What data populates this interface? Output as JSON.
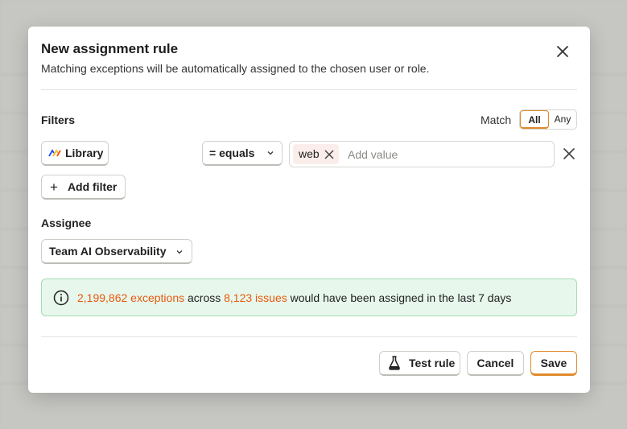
{
  "modal": {
    "title": "New assignment rule",
    "subtitle": "Matching exceptions will be automatically assigned to the chosen user or role."
  },
  "filters": {
    "section_label": "Filters",
    "match_label": "Match",
    "match_options": [
      "All",
      "Any"
    ],
    "match_selected": "All",
    "rows": [
      {
        "property": "Library",
        "operator": "= equals",
        "values": [
          "web"
        ],
        "placeholder": "Add value"
      }
    ],
    "add_filter_label": "Add filter"
  },
  "assignee": {
    "section_label": "Assignee",
    "selected": "Team AI Observability"
  },
  "info": {
    "exceptions": "2,199,862 exceptions",
    "across": " across ",
    "issues": "8,123 issues",
    "suffix": " would have been assigned in the last 7 days"
  },
  "footer": {
    "test_label": "Test rule",
    "cancel_label": "Cancel",
    "save_label": "Save"
  },
  "colors": {
    "accent": "#e08a2b",
    "highlight": "#e8590c",
    "success_bg": "#e7f7ec",
    "success_border": "#a4dcb5"
  },
  "icons": [
    "close-icon",
    "library-icon",
    "chevron-down-icon",
    "remove-chip-icon",
    "remove-filter-icon",
    "plus-icon",
    "info-icon",
    "flask-icon"
  ]
}
